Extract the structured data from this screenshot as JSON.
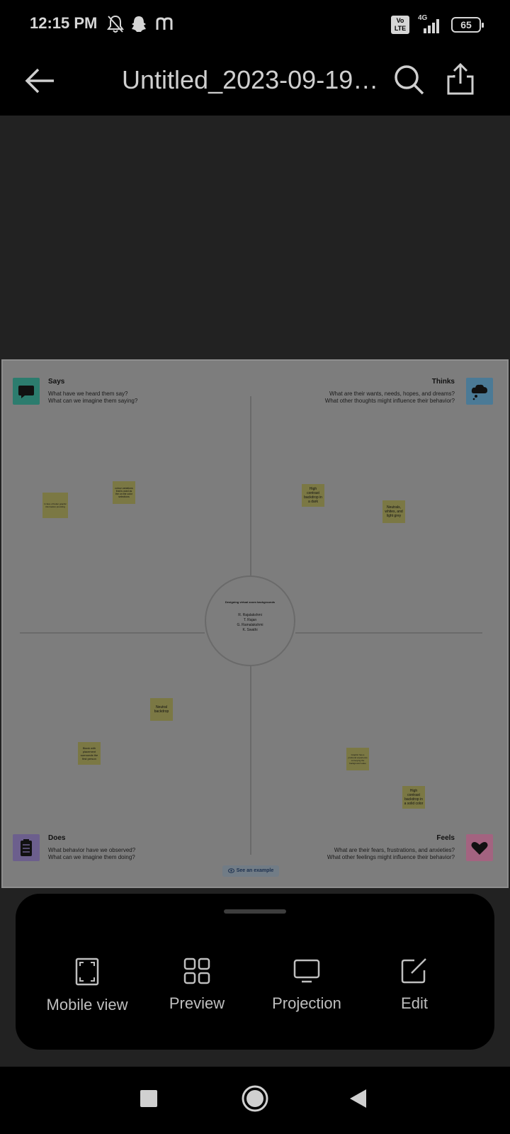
{
  "status_bar": {
    "time": "12:15 PM",
    "icons": [
      "bell-off-icon",
      "snapchat-icon",
      "m-app-icon",
      "volte-icon",
      "4g-signal-icon"
    ],
    "network": "4G",
    "volte": "Vo LTE",
    "battery": "65"
  },
  "app_bar": {
    "title": "Untitled_2023-09-19_..."
  },
  "board": {
    "says": {
      "title": "Says",
      "desc1": "What have we heard them say?",
      "desc2": "What can we imagine them saying?",
      "color": "#2c7c6e"
    },
    "thinks": {
      "title": "Thinks",
      "desc1": "What are their wants, needs, hopes, and dreams?",
      "desc2": "What other thoughts might influence their behavior?",
      "color": "#4b7a96"
    },
    "does": {
      "title": "Does",
      "desc1": "What behavior have we observed?",
      "desc2": "What can we imagine them doing?",
      "color": "#6c5f8d"
    },
    "feels": {
      "title": "Feels",
      "desc1": "What are their fears, frustrations, and anxieties?",
      "desc2": "What other feelings might influence their behavior?",
      "color": "#a36380"
    },
    "center": {
      "title": "Designing virtual zoom backgrounds",
      "names": [
        "R. Rajalakshmi",
        "T. Rajan",
        "G. Ramalakshmi",
        "K. Swathi"
      ]
    },
    "stickies": [
      "In face of better graphic information providing",
      "colour variations that is used as the on the color selections",
      "High contrast backdrop in a dark",
      "Neutrals, whites, and light grey",
      "Neutral backdrop",
      "Blank with placement surrounds the first person",
      "Graphic has a profound experience conveying the background value",
      "High contrast backdrop in a solid color"
    ],
    "see_example": "See an example",
    "sticky_color": "#7b7844"
  },
  "sheet": {
    "actions": [
      {
        "label": "Mobile view",
        "icon": "mobile-view-icon"
      },
      {
        "label": "Preview",
        "icon": "grid-icon"
      },
      {
        "label": "Projection",
        "icon": "monitor-icon"
      },
      {
        "label": "Edit",
        "icon": "edit-icon"
      }
    ]
  },
  "nav_bar": {
    "icons": [
      "recents-square-icon",
      "home-circle-icon",
      "back-triangle-icon"
    ]
  }
}
